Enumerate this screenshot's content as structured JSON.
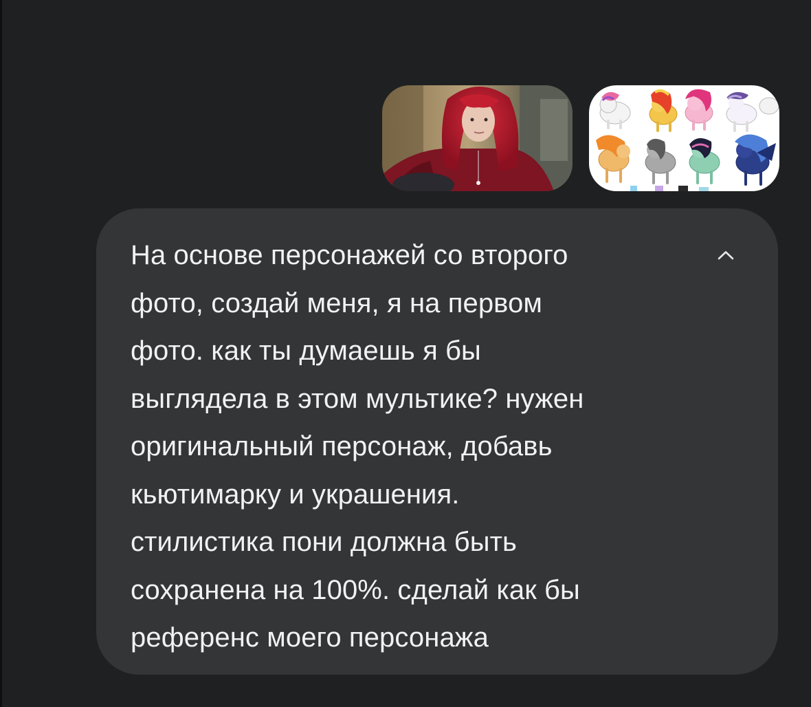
{
  "attachments": [
    {
      "name": "photo-1",
      "icon": "portrait-photo"
    },
    {
      "name": "photo-2",
      "icon": "pony-collage-photo"
    }
  ],
  "message": {
    "text": "На основе персонажей со второго\nфото, создай меня, я на первом\nфото. как ты думаешь я бы\nвыглядела в этом мультике? нужен\nоригинальный персонаж, добавь\nкьютимарку и украшения.\nстилистика пони должна быть\nсохранена на 100%. сделай как бы\nреференс моего персонажа",
    "collapse_icon": "chevron-up-icon"
  },
  "colors": {
    "background": "#1f2021",
    "bubble": "#333536",
    "text": "#f1f2f3"
  }
}
